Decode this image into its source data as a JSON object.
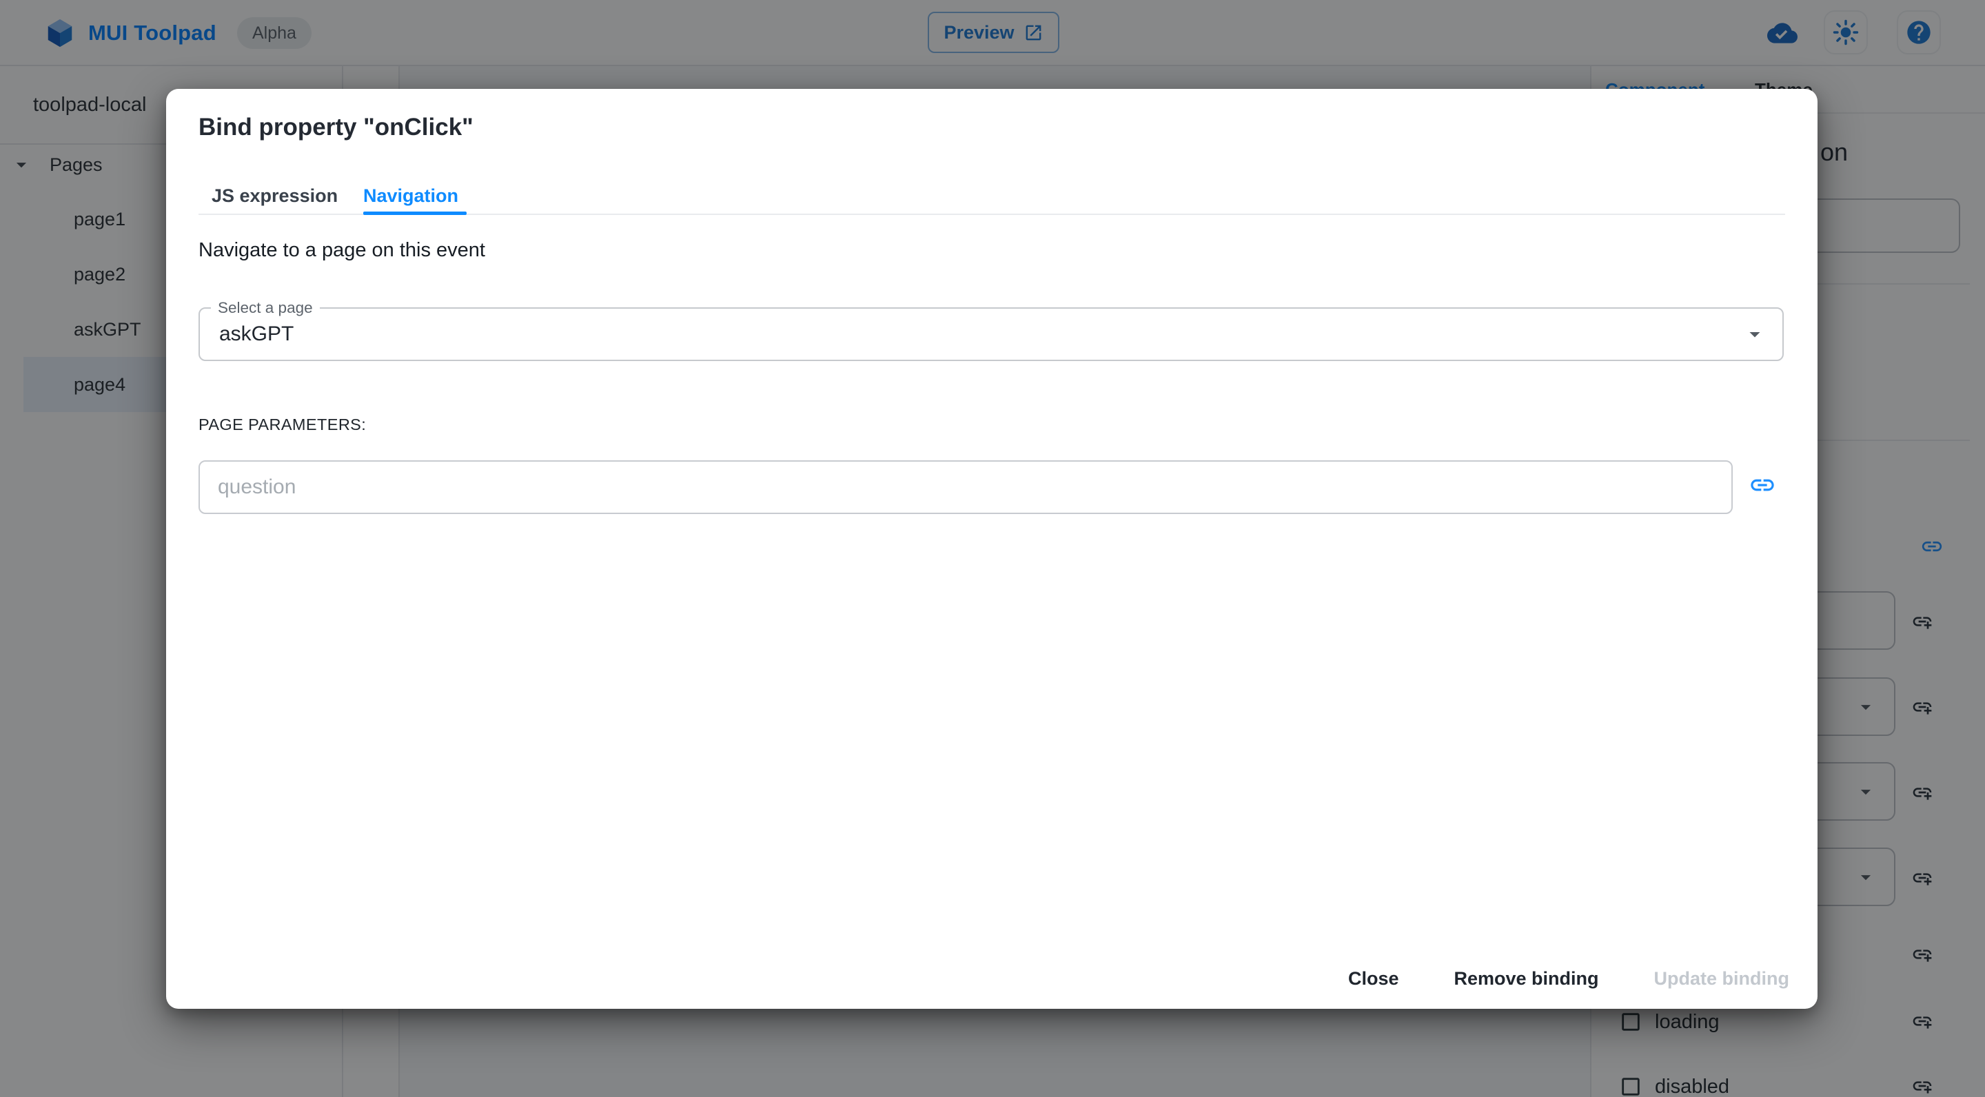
{
  "topbar": {
    "brand": "MUI Toolpad",
    "badge": "Alpha",
    "preview": "Preview"
  },
  "sidebar": {
    "project": "toolpad-local",
    "section": "Pages",
    "pages": [
      "page1",
      "page2",
      "askGPT",
      "page4"
    ],
    "selected_page": "page4"
  },
  "right_panel": {
    "tab_component": "Component",
    "tab_theme": "Theme",
    "heading_visible": "on",
    "checkboxes": [
      "loading",
      "disabled"
    ]
  },
  "dialog": {
    "title": "Bind property \"onClick\"",
    "tab_js": "JS expression",
    "tab_nav": "Navigation",
    "active_tab": "Navigation",
    "description": "Navigate to a page on this event",
    "select_label": "Select a page",
    "select_value": "askGPT",
    "params_heading": "PAGE PARAMETERS:",
    "param_placeholder": "question",
    "close": "Close",
    "remove": "Remove binding",
    "update": "Update binding"
  },
  "colors": {
    "accent": "#0e8bff",
    "primary": "#1976d2",
    "brand_blue": "#007fff",
    "selected_row_bg": "#e8f0fa"
  }
}
